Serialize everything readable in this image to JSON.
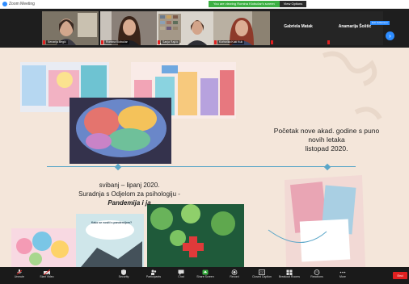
{
  "window": {
    "title": "Zoom Meeting"
  },
  "share_banner": {
    "message": "You are viewing Romina Klobučar's screen",
    "view_options": "View Options"
  },
  "gallery_button": "Exit Fullscreen",
  "participants": [
    {
      "name": "Senarija Begić"
    },
    {
      "name": "Romina Klobučar"
    },
    {
      "name": "Sanja Rajčić"
    },
    {
      "name": "Korisnika Kuki Kuk"
    },
    {
      "name": "Gabriela Matak",
      "video": false
    },
    {
      "name": "Anamarija Šoštić",
      "video": false
    }
  ],
  "slide": {
    "heading_right": [
      "Početak nove akad. godine s puno",
      "novih letaka",
      "listopad 2020."
    ],
    "heading_left": [
      "svibanj – lipanj 2020.",
      "Suradnja s Odjelom za psihologiju -"
    ],
    "heading_left_italic": "Pandemija i ja",
    "poster_text": "Kako se nositi s pandemijom?"
  },
  "toolbar": {
    "items": [
      {
        "label": "Unmute",
        "icon": "microphone-icon"
      },
      {
        "label": "Start Video",
        "icon": "video-camera-icon"
      },
      {
        "label": "Security",
        "icon": "shield-icon"
      },
      {
        "label": "Participants",
        "icon": "participants-icon",
        "count": "6"
      },
      {
        "label": "Chat",
        "icon": "chat-icon"
      },
      {
        "label": "Share Screen",
        "icon": "share-screen-icon"
      },
      {
        "label": "Record",
        "icon": "record-icon"
      },
      {
        "label": "Closed Caption",
        "icon": "cc-icon"
      },
      {
        "label": "Breakout Rooms",
        "icon": "breakout-rooms-icon"
      },
      {
        "label": "Reactions",
        "icon": "reactions-icon"
      },
      {
        "label": "More",
        "icon": "more-icon"
      }
    ],
    "end": "End"
  },
  "colors": {
    "accent": "#2d8cff",
    "timeline": "#5aa6c8",
    "end": "#e02020",
    "slide_bg": "#f4e6da"
  }
}
